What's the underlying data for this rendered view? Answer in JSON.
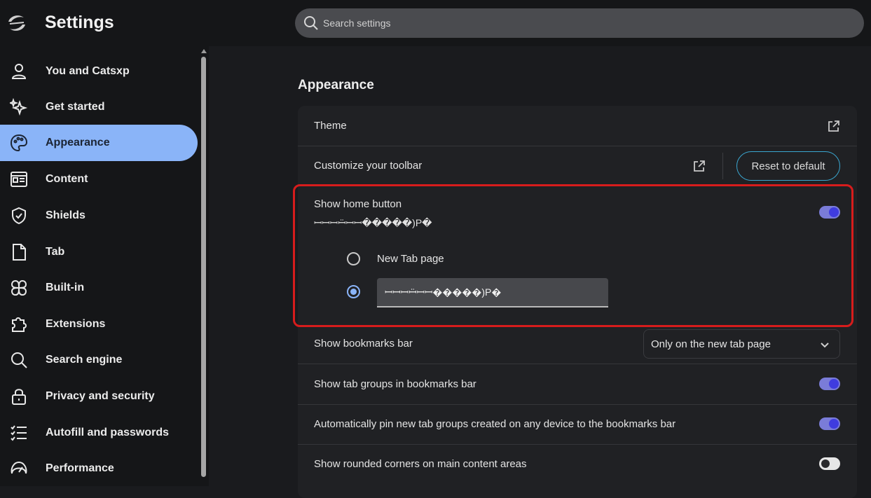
{
  "app": {
    "title": "Settings",
    "logo_icon": "browser-logo-icon"
  },
  "search": {
    "placeholder": "Search settings",
    "icon": "search-icon"
  },
  "sidebar": {
    "items": [
      {
        "label": "You and Catsxp",
        "icon": "person-icon"
      },
      {
        "label": "Get started",
        "icon": "sparkle-stars-icon"
      },
      {
        "label": "Appearance",
        "icon": "palette-icon",
        "active": true
      },
      {
        "label": "Content",
        "icon": "content-page-icon"
      },
      {
        "label": "Shields",
        "icon": "shield-check-icon"
      },
      {
        "label": "Tab",
        "icon": "document-icon"
      },
      {
        "label": "Built-in",
        "icon": "clover-icon"
      },
      {
        "label": "Extensions",
        "icon": "puzzle-icon"
      },
      {
        "label": "Search engine",
        "icon": "magnifier-icon"
      },
      {
        "label": "Privacy and security",
        "icon": "lock-icon"
      },
      {
        "label": "Autofill and passwords",
        "icon": "list-check-icon"
      },
      {
        "label": "Performance",
        "icon": "speedometer-icon"
      }
    ]
  },
  "main": {
    "section_title": "Appearance",
    "theme_label": "Theme",
    "toolbar_label": "Customize your toolbar",
    "reset_label": "Reset to default",
    "home_button": {
      "label": "Show home button",
      "sub": "ꟷꟷꟷꟷ̈ꟷꟷ�����)P�",
      "enabled": true,
      "option_newtab": "New Tab page",
      "custom_url_value": "ꟷꟷꟷꟷ̈ꟷꟷ�����)P�"
    },
    "bookmarks_bar": {
      "label": "Show bookmarks bar",
      "selected": "Only on the new tab page"
    },
    "tab_groups": {
      "label": "Show tab groups in bookmarks bar",
      "enabled": true
    },
    "auto_pin": {
      "label": "Automatically pin new tab groups created on any device to the bookmarks bar",
      "enabled": true
    },
    "rounded": {
      "label": "Show rounded corners on main content areas",
      "enabled": false
    }
  },
  "colors": {
    "accent": "#8ab4f8",
    "toggle_on": "#7a7cd8",
    "highlight_border": "#d71c1c",
    "reset_border": "#3aa6d0"
  }
}
